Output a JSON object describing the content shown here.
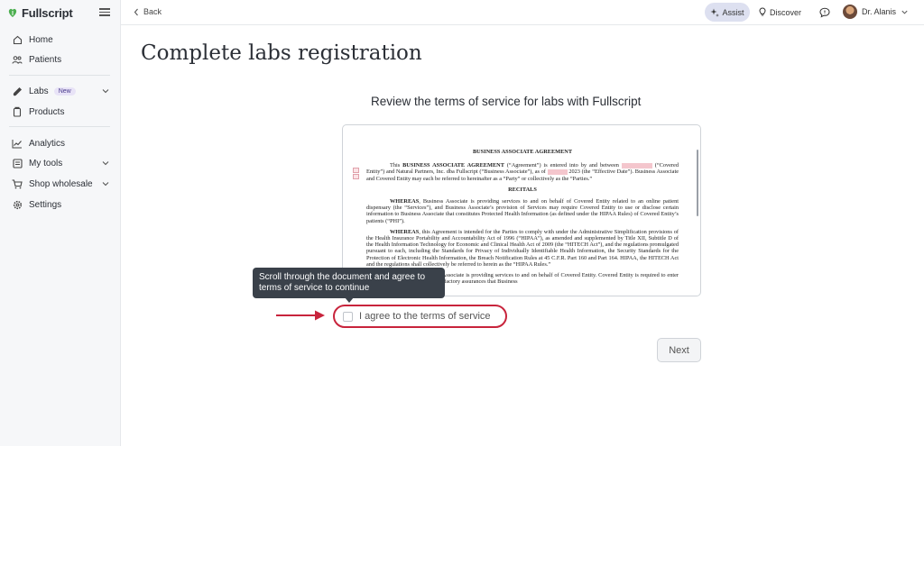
{
  "brand": {
    "name": "Fullscript",
    "color": "#4caf50"
  },
  "sidebar": {
    "items": [
      {
        "label": "Home",
        "icon": "home-icon"
      },
      {
        "label": "Patients",
        "icon": "patients-icon"
      },
      {
        "label": "Labs",
        "icon": "labs-icon",
        "badge": "New",
        "has_chevron": true
      },
      {
        "label": "Products",
        "icon": "products-icon"
      },
      {
        "label": "Analytics",
        "icon": "analytics-icon"
      },
      {
        "label": "My tools",
        "icon": "tools-icon",
        "has_chevron": true
      },
      {
        "label": "Shop wholesale",
        "icon": "cart-icon",
        "has_chevron": true
      },
      {
        "label": "Settings",
        "icon": "gear-icon"
      }
    ]
  },
  "topbar": {
    "back_label": "Back",
    "assist_label": "Assist",
    "discover_label": "Discover",
    "user_name": "Dr. Alanis"
  },
  "main": {
    "page_title": "Complete labs registration",
    "subtitle": "Review the terms of service for labs with Fullscript",
    "document": {
      "heading": "BUSINESS ASSOCIATE AGREEMENT",
      "para1_pre": "This ",
      "para1_bold": "BUSINESS ASSOCIATE AGREEMENT",
      "para1_mid": " (“Agreement”) is entered into by and between ",
      "para1_rest": " (“Covered Entity”) and Natural Partners, Inc. dba Fullscript (“Business Associate”), as of ",
      "para1_end": " 2023 (the “Effective Date”). Business Associate and Covered Entity may each be referred to hereinafter as a “Party” or collectively as the “Parties.”",
      "recitals": "RECITALS",
      "whereas1_bold": "WHEREAS",
      "whereas1": ", Business Associate is providing services to and on behalf of Covered Entity related to an online patient dispensary (the “Services”), and Business Associate’s provision of Services may require Covered Entity to use or disclose certain information to Business Associate that constitutes Protected Health Information (as defined under the HIPAA Rules) of Covered Entity’s patients (“PHI”).",
      "whereas2_bold": "WHEREAS",
      "whereas2": ", this Agreement is intended for the Parties to comply with under the Administrative Simplification provisions of the Health Insurance Portability and Accountability Act of 1996 (“HIPAA”), as amended and supplemented by Title XII, Subtitle D of the Health Information Technology for Economic and Clinical Health Act of 2009 (the “HITECH Act”), and the regulations promulgated pursuant to each, including the Standards for Privacy of Individually Identifiable Health Information, the Security Standards for the Protection of Electronic Health Information, the Breach Notification Rules at 45 C.F.R. Part 160 and Part 164. HIPAA, the HITECH Act and the regulations shall collectively be referred to herein as the “HIPAA Rules.”",
      "whereas3": "WHEREAS, Business Associate is providing services to and on behalf of Covered Entity. Covered Entity is required to enter into this Agreement to obtain satisfactory assurances that Business"
    },
    "tooltip": "Scroll through the document and agree to terms of service to continue",
    "agree_label": "I agree to the terms of service",
    "agree_checked": false,
    "next_label": "Next",
    "highlight_color": "#c8243c"
  }
}
